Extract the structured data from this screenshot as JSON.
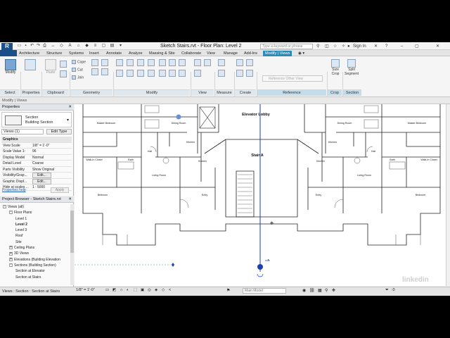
{
  "app": {
    "logo": "R",
    "title": "Sketch Stairs.rvt - Floor Plan: Level 2",
    "search_placeholder": "Type a keyword or phrase",
    "sign_in": "Sign In",
    "help": "?"
  },
  "tabs": [
    "Architecture",
    "Structure",
    "Systems",
    "Insert",
    "Annotate",
    "Analyze",
    "Massing & Site",
    "Collaborate",
    "View",
    "Manage",
    "Add-Ins",
    "Modify | Views"
  ],
  "ribbon": {
    "select": {
      "label": "Select",
      "button": "Modify"
    },
    "properties": {
      "label": "Properties",
      "button": ""
    },
    "clipboard": {
      "label": "Clipboard",
      "paste": "Paste"
    },
    "geometry": {
      "label": "Geometry",
      "items": [
        "Cope",
        "Cut",
        "Join"
      ]
    },
    "modify": {
      "label": "Modify"
    },
    "view": {
      "label": "View"
    },
    "measure": {
      "label": "Measure"
    },
    "create": {
      "label": "Create"
    },
    "reference": {
      "label": "Reference",
      "combo": "Reference Other View"
    },
    "crop": {
      "label": "Crop",
      "button": "Size Crop"
    },
    "section": {
      "label": "Section",
      "button": "Split Segment"
    }
  },
  "options_bar": "Modify | Views",
  "properties": {
    "header": "Properties",
    "type_line1": "Section",
    "type_line2": "Building Section",
    "views_combo": "Views (1)",
    "edit_type": "Edit Type",
    "rows": [
      {
        "k": "Graphics",
        "v": "",
        "group": true
      },
      {
        "k": "View Scale",
        "v": "1/8\" = 1'-0\""
      },
      {
        "k": "Scale Value  1:",
        "v": "96"
      },
      {
        "k": "Display Model",
        "v": "Normal"
      },
      {
        "k": "Detail Level",
        "v": "Coarse"
      },
      {
        "k": "Parts Visibility",
        "v": "Show Original"
      },
      {
        "k": "Visibility/Grap...",
        "v": "Edit...",
        "btn": true
      },
      {
        "k": "Graphic Displ...",
        "v": "Edit...",
        "btn": true
      },
      {
        "k": "Hide at scales ...",
        "v": "1 : 5000"
      }
    ],
    "help": "Properties help",
    "apply": "Apply"
  },
  "project_browser": {
    "header": "Project Browser - Sketch Stairs.rvt",
    "nodes": [
      {
        "label": "Views (all)",
        "depth": 0,
        "tw": "-"
      },
      {
        "label": "Floor Plans",
        "depth": 1,
        "tw": "-"
      },
      {
        "label": "Level 1",
        "depth": 2
      },
      {
        "label": "Level 2",
        "depth": 2,
        "bold": true
      },
      {
        "label": "Level 3",
        "depth": 2
      },
      {
        "label": "Roof",
        "depth": 2
      },
      {
        "label": "Site",
        "depth": 2
      },
      {
        "label": "Ceiling Plans",
        "depth": 1,
        "tw": "+"
      },
      {
        "label": "3D Views",
        "depth": 1,
        "tw": "+"
      },
      {
        "label": "Elevations (Building Elevation",
        "depth": 1,
        "tw": "+"
      },
      {
        "label": "Sections (Building Section)",
        "depth": 1,
        "tw": "-"
      },
      {
        "label": "Section at Elevator",
        "depth": 2
      },
      {
        "label": "Section at Stairs",
        "depth": 2
      }
    ]
  },
  "plan": {
    "elevator_lobby": "Elevator Lobby",
    "stair_a": "Stair A",
    "rooms_left": [
      "Master Bedroom",
      "Dining Room",
      "Kitchen",
      "Living Room",
      "Bedroom",
      "Bath",
      "Walk-In Closet",
      "Hall",
      "Entry",
      "Kitchen"
    ],
    "rooms_right": [
      "Dining Room",
      "Master Bedroom",
      "Kitchen",
      "Living Room",
      "Bedroom",
      "Bath",
      "Walk-In Closet",
      "Hall",
      "Entry",
      "Kitchen"
    ]
  },
  "status": {
    "left": "Views : Section : Section at Stairs",
    "scale": "1/8\" = 1'-0\"",
    "model": "Main Model",
    "filter": ":0"
  },
  "watermark": "linkedin"
}
